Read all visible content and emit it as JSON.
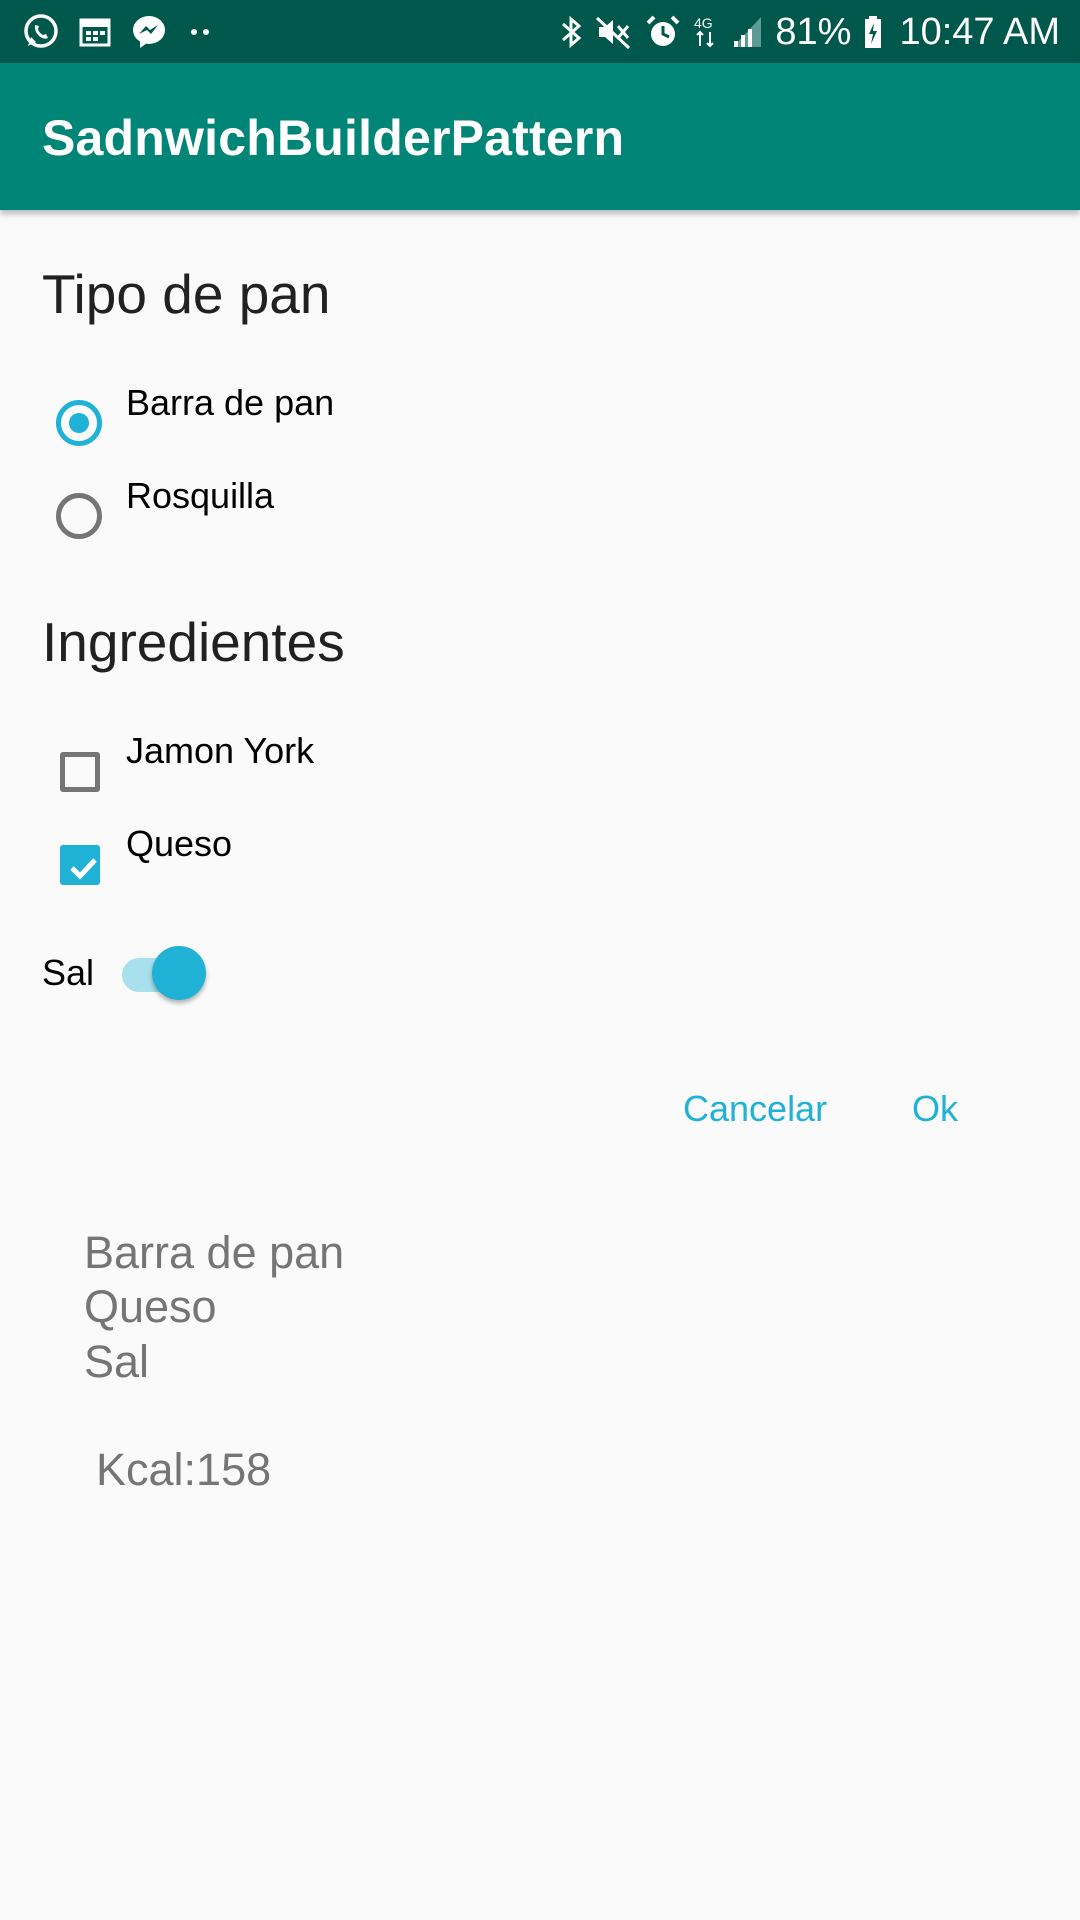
{
  "status_bar": {
    "left_icons": [
      "whatsapp-icon",
      "calendar-icon",
      "messenger-icon",
      "more-dots-icon"
    ],
    "right_icons": [
      "bluetooth-icon",
      "mute-icon",
      "alarm-icon",
      "network-4g-icon",
      "signal-icon"
    ],
    "battery": "81%",
    "time": "10:47 AM"
  },
  "app_bar": {
    "title": "SadnwichBuilderPattern"
  },
  "bread": {
    "heading": "Tipo de pan",
    "options": [
      {
        "label": "Barra de pan",
        "selected": true
      },
      {
        "label": "Rosquilla",
        "selected": false
      }
    ]
  },
  "ingredients": {
    "heading": "Ingredientes",
    "options": [
      {
        "label": "Jamon York",
        "checked": false
      },
      {
        "label": "Queso",
        "checked": true
      }
    ]
  },
  "salt": {
    "label": "Sal",
    "on": true
  },
  "actions": {
    "cancel_label": "Cancelar",
    "ok_label": "Ok"
  },
  "summary": {
    "lines": [
      "Barra de pan",
      "Queso",
      "Sal"
    ],
    "kcal": "Kcal:158"
  },
  "colors": {
    "status_bar": "#00574b",
    "app_bar": "#008577",
    "accent": "#1fb2d6"
  }
}
